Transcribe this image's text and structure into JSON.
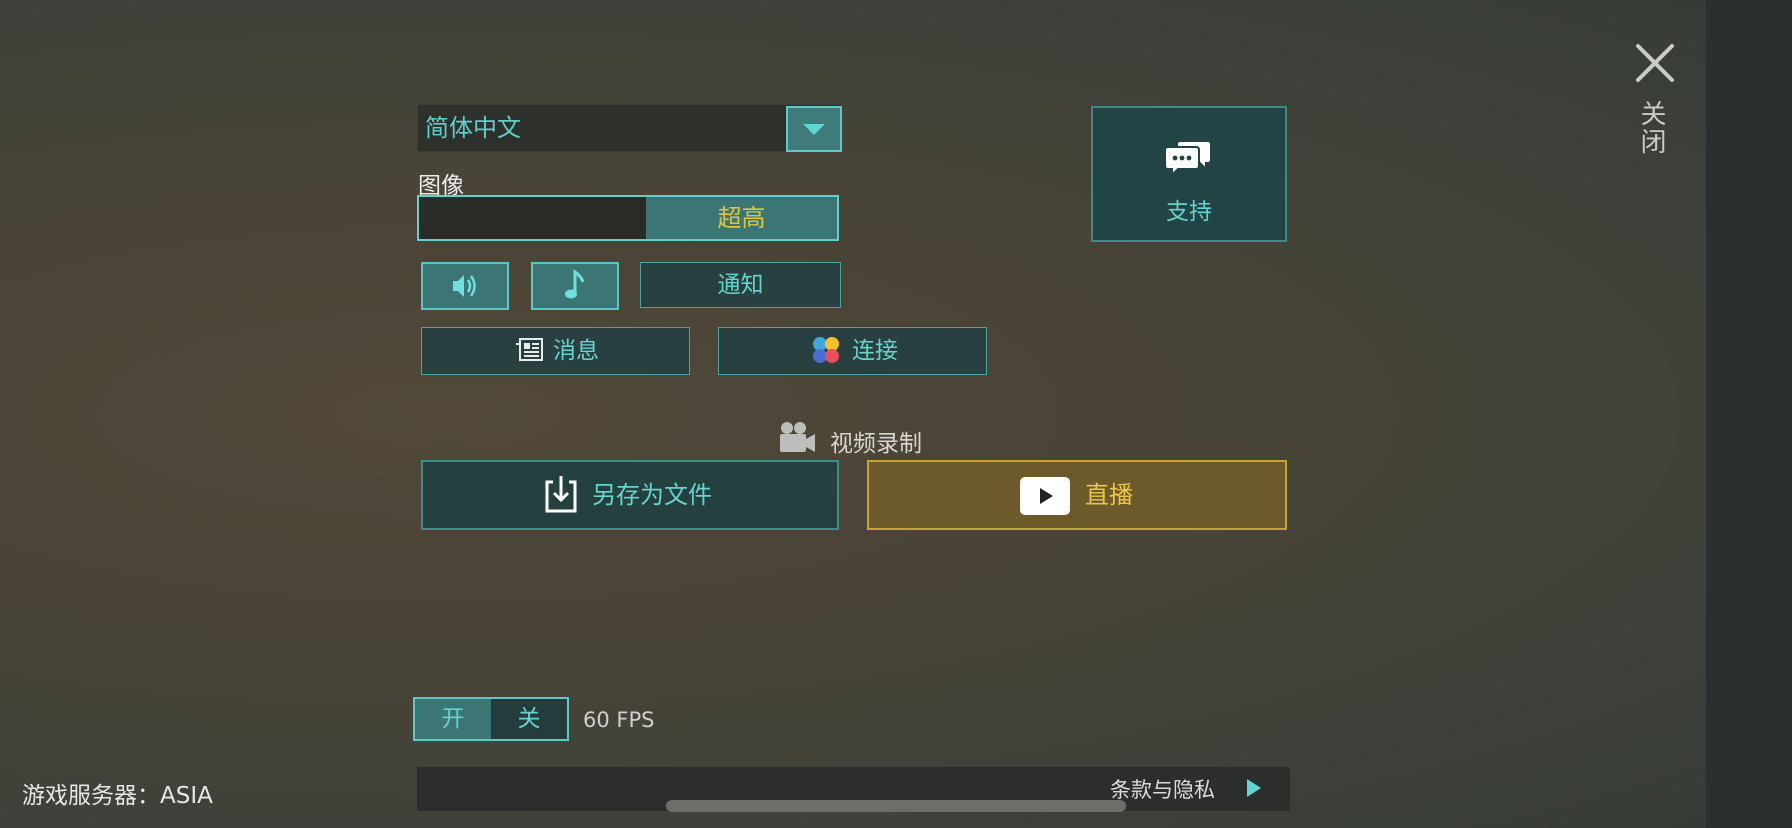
{
  "language": {
    "selected": "简体中文"
  },
  "graphics": {
    "label": "图像",
    "value": "超高"
  },
  "sound": {
    "notify_label": "通知"
  },
  "links": {
    "news_label": "消息",
    "connect_label": "连接"
  },
  "support": {
    "label": "支持"
  },
  "recording": {
    "label": "视频录制",
    "save_label": "另存为文件",
    "live_label": "直播"
  },
  "fps_toggle": {
    "on": "开",
    "off": "关",
    "fps_label": "60 FPS"
  },
  "server": {
    "label": "游戏服务器：ASIA"
  },
  "terms": {
    "label": "条款与隐私"
  },
  "close": {
    "label": "关闭"
  },
  "colors": {
    "accent": "#5ecac6",
    "highlight": "#e3c43f",
    "live_bg": "#6c5a2a"
  }
}
